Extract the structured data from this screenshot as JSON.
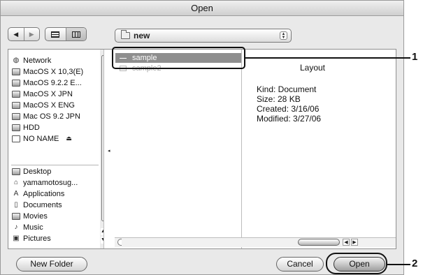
{
  "window": {
    "title": "Open"
  },
  "toolbar": {
    "back_icon": "back-arrow-icon",
    "forward_icon": "forward-arrow-icon",
    "list_view_icon": "list-view-icon",
    "column_view_icon": "column-view-icon",
    "location": "new"
  },
  "sidebar": {
    "devices": [
      {
        "label": "Network",
        "icon": "network-icon"
      },
      {
        "label": "MacOS X 10,3(E)",
        "icon": "disk-icon"
      },
      {
        "label": "MacOS 9.2.2 E...",
        "icon": "disk-icon"
      },
      {
        "label": "MacOS X JPN",
        "icon": "disk-icon"
      },
      {
        "label": "MacOS X ENG",
        "icon": "disk-icon"
      },
      {
        "label": "Mac OS 9.2 JPN",
        "icon": "disk-icon"
      },
      {
        "label": "HDD",
        "icon": "disk-icon"
      },
      {
        "label": "NO NAME",
        "icon": "removable-disk-icon"
      }
    ],
    "places": [
      {
        "label": "Desktop",
        "icon": "desktop-icon"
      },
      {
        "label": "yamamotosug...",
        "icon": "home-icon"
      },
      {
        "label": "Applications",
        "icon": "applications-icon"
      },
      {
        "label": "Documents",
        "icon": "documents-icon"
      },
      {
        "label": "Movies",
        "icon": "movies-icon"
      },
      {
        "label": "Music",
        "icon": "music-icon"
      },
      {
        "label": "Pictures",
        "icon": "pictures-icon"
      }
    ]
  },
  "files": [
    {
      "name": "sample",
      "selected": true
    },
    {
      "name": "sample2",
      "selected": false
    }
  ],
  "preview": {
    "title": "Layout",
    "kind": "Kind: Document",
    "size": "Size: 28 KB",
    "created": "Created: 3/16/06",
    "modified": "Modified: 3/27/06"
  },
  "buttons": {
    "new_folder": "New Folder",
    "cancel": "Cancel",
    "open": "Open"
  },
  "callouts": {
    "one": "1",
    "two": "2"
  },
  "colors": {
    "selection": "#8e8e8e",
    "dialog_bg": "#e9e9e9"
  }
}
